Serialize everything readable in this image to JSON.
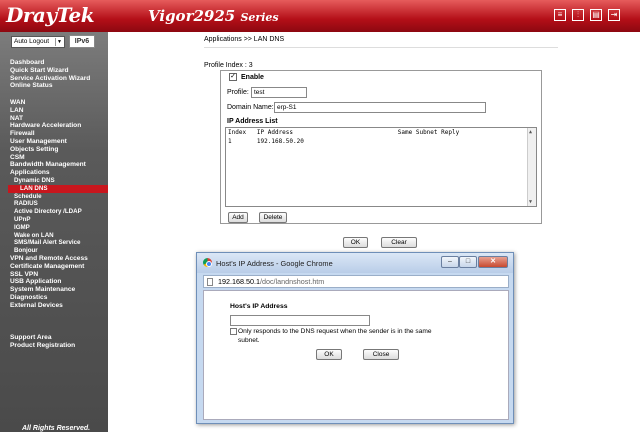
{
  "header": {
    "logo": "DrayTek",
    "model_name": "Vigor2925",
    "model_series": "Series",
    "icons": [
      "bars-icon",
      "sliders-icon",
      "chart-icon",
      "logout-icon"
    ]
  },
  "sidebar": {
    "auto_logout": "Auto Logout",
    "ipv6_badge": "IPv6",
    "group1": [
      "Dashboard",
      "Quick Start Wizard",
      "Service Activation Wizard",
      "Online Status"
    ],
    "group2": [
      "WAN",
      "LAN",
      "NAT",
      "Hardware Acceleration",
      "Firewall",
      "User Management",
      "Objects Setting",
      "CSM",
      "Bandwidth Management",
      "Applications"
    ],
    "applications_sub": [
      "Dynamic DNS",
      "LAN DNS",
      "Schedule",
      "RADIUS",
      "Active Directory /LDAP",
      "UPnP",
      "IGMP",
      "Wake on LAN",
      "SMS/Mail Alert Service",
      "Bonjour"
    ],
    "group3": [
      "VPN and Remote Access",
      "Certificate Management",
      "SSL VPN",
      "USB Application",
      "System Maintenance",
      "Diagnostics",
      "External Devices"
    ],
    "group4": [
      "Support Area",
      "Product Registration"
    ],
    "footer": "All Rights Reserved."
  },
  "main": {
    "breadcrumb": "Applications >> LAN DNS",
    "profile_index": "Profile Index : 3",
    "enable_label": "Enable",
    "enable_checked": true,
    "profile_label": "Profile:",
    "profile_value": "test",
    "domain_label": "Domain Name:",
    "domain_value": "erp-S1",
    "ip_list_title": "IP Address List",
    "ip_list_header": "Index   IP Address                             Same Subnet Reply",
    "ip_list_rows": [
      "1       192.168.50.20"
    ],
    "add_button": "Add",
    "delete_button": "Delete",
    "ok_button": "OK",
    "clear_button": "Clear"
  },
  "popup": {
    "title": "Host's IP Address - Google Chrome",
    "url_host": "192.168.50.1",
    "url_path": "/doc/landnshost.htm",
    "heading": "Host's IP Address",
    "ip_value": "",
    "checkbox_text": "Only responds to the DNS request when the sender is in the same subnet.",
    "ok_button": "OK",
    "close_button": "Close",
    "minimize": "–",
    "maximize": "□",
    "close": "✕"
  }
}
